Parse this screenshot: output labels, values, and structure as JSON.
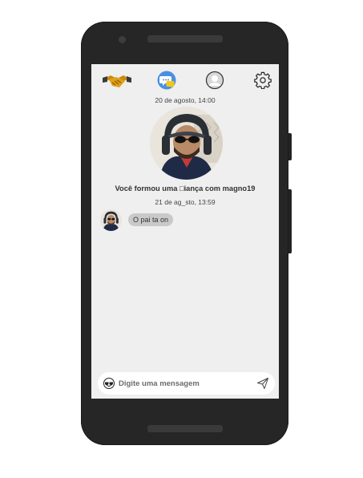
{
  "topbar": {
    "icons": [
      "handshake-icon",
      "chat-bubble-icon",
      "profile-icon",
      "gear-icon"
    ],
    "active_icon": "chat-bubble-icon",
    "accent_color": "#4a90e2"
  },
  "conversation": {
    "date_1": "20 de agosto, 14:00",
    "alliance_text": "Você formou uma □iança com magno19",
    "date_2": "21 de ag_sto, 13:59",
    "messages": [
      {
        "text": "O pai ta on"
      }
    ]
  },
  "composer": {
    "placeholder": "Digite uma mensagem",
    "emoji_icon": "sunglasses-emoji-icon",
    "send_icon": "send-icon"
  }
}
